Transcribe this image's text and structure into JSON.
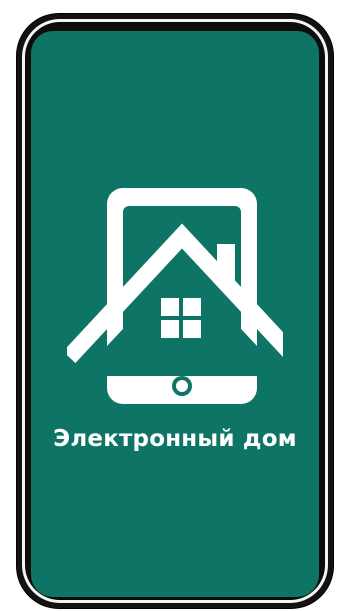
{
  "app": {
    "name": "Электронный дом",
    "logo_icon": "house-in-smartphone-icon"
  },
  "colors": {
    "screen_background": "#0e7466",
    "logo_foreground": "#ffffff",
    "phone_frame": "#121212"
  }
}
